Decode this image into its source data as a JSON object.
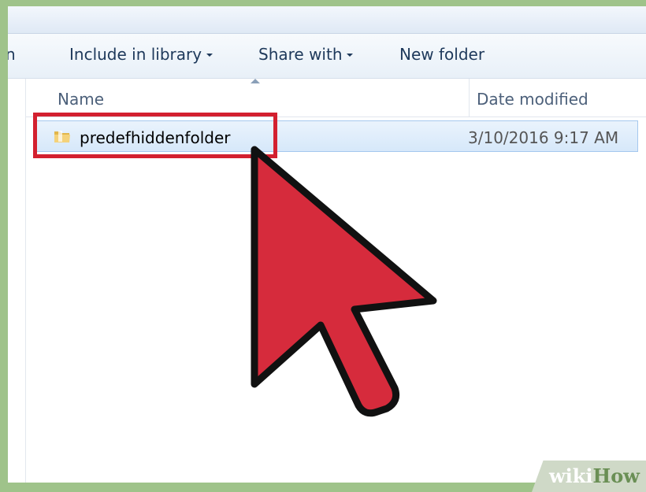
{
  "toolbar": {
    "truncated_left": "n",
    "include_in_library": "Include in library",
    "share_with": "Share with",
    "new_folder": "New folder"
  },
  "columns": {
    "name": "Name",
    "date_modified": "Date modified"
  },
  "files": [
    {
      "name": "predefhiddenfolder",
      "date_modified": "3/10/2016 9:17 AM",
      "icon": "folder-icon",
      "selected": true
    }
  ],
  "watermark": {
    "part1": "wiki",
    "part2": "How"
  },
  "colors": {
    "highlight": "#d3202f",
    "cursor": "#d62b3c",
    "background": "#9fc38a",
    "selection": "#d6e8fa"
  }
}
